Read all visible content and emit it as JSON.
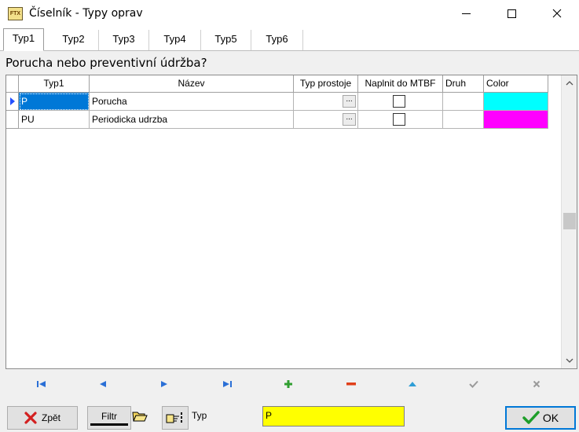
{
  "window": {
    "title": "Číselník - Typy  oprav",
    "app_icon_text": "FTX"
  },
  "tabs": [
    {
      "label": "Typ1",
      "active": true
    },
    {
      "label": "Typ2",
      "active": false
    },
    {
      "label": "Typ3",
      "active": false
    },
    {
      "label": "Typ4",
      "active": false
    },
    {
      "label": "Typ5",
      "active": false
    },
    {
      "label": "Typ6",
      "active": false
    }
  ],
  "heading": "Porucha nebo preventivní údržba?",
  "grid": {
    "columns": [
      "Typ1",
      "Název",
      "Typ prostoje",
      "Naplnit do MTBF",
      "Druh",
      "Color"
    ],
    "rows": [
      {
        "typ1": "P",
        "nazev": "Porucha",
        "typ_prostoje_button": "...",
        "mtbf_checked": false,
        "druh": "",
        "color": "#00ffff",
        "current": true
      },
      {
        "typ1": "PU",
        "nazev": "Periodicka udrzba",
        "typ_prostoje_button": "...",
        "mtbf_checked": false,
        "druh": "",
        "color": "#ff00ff",
        "current": false
      }
    ]
  },
  "navigator": [
    "first-icon",
    "prior-icon",
    "next-icon",
    "last-icon",
    "insert-icon",
    "delete-icon",
    "edit-icon",
    "post-icon",
    "cancel-icon"
  ],
  "bottom": {
    "back_label": "Zpět",
    "filter_label": "Filtr",
    "field_label": "Typ",
    "field_value": "P",
    "ok_label": "OK"
  },
  "colors": {
    "selection": "#0078d7",
    "field_highlight": "#ffff00",
    "nav_blue": "#2a6fd6",
    "nav_green": "#2f9e2f",
    "nav_red": "#e0401a"
  }
}
